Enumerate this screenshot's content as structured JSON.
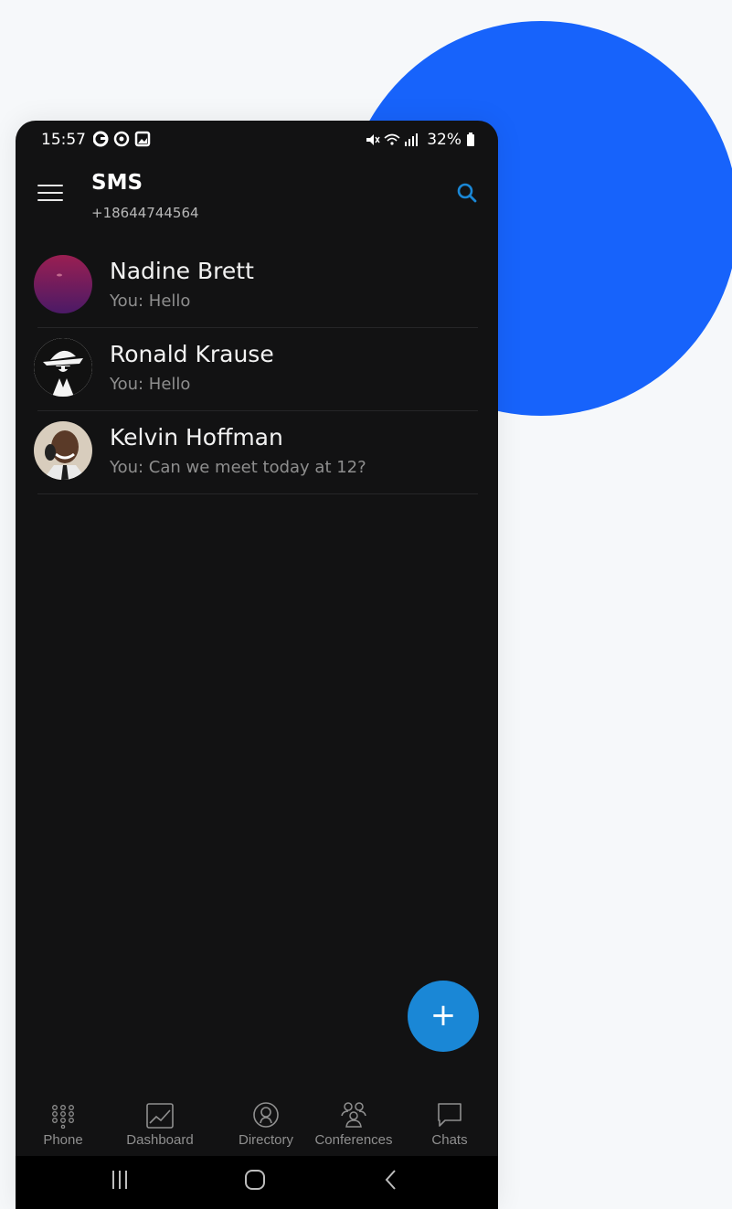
{
  "status": {
    "time": "15:57",
    "battery": "32%"
  },
  "header": {
    "title": "SMS",
    "subtitle": "+18644744564"
  },
  "conversations": [
    {
      "name": "Nadine Brett",
      "preview": "You: Hello"
    },
    {
      "name": "Ronald Krause",
      "preview": "You: Hello"
    },
    {
      "name": "Kelvin Hoffman",
      "preview": "You: Can we meet today at 12?"
    }
  ],
  "fab": {
    "label": "+"
  },
  "nav": [
    {
      "label": "Phone",
      "icon": "dialpad-icon"
    },
    {
      "label": "Dashboard",
      "icon": "chart-icon"
    },
    {
      "label": "Directory",
      "icon": "contact-icon"
    },
    {
      "label": "Conferences",
      "icon": "group-icon"
    },
    {
      "label": "Chats",
      "icon": "chat-bubble-icon"
    }
  ],
  "colors": {
    "accent": "#1a87d6",
    "blob": "#1763fb",
    "background": "#121213"
  }
}
